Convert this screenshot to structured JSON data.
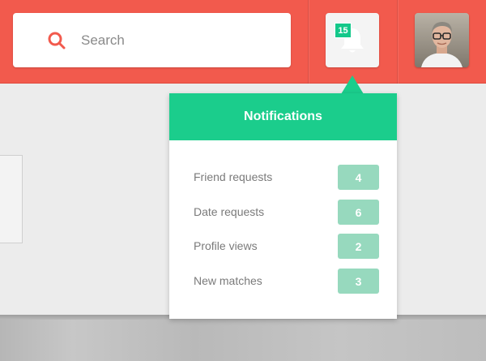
{
  "search": {
    "placeholder": "Search"
  },
  "notifications_button": {
    "badge": "15"
  },
  "dropdown": {
    "title": "Notifications",
    "items": [
      {
        "label": "Friend requests",
        "count": "4"
      },
      {
        "label": "Date requests",
        "count": "6"
      },
      {
        "label": "Profile views",
        "count": "2"
      },
      {
        "label": "New matches",
        "count": "3"
      }
    ]
  },
  "colors": {
    "topbar": "#f25a4d",
    "accent_green": "#1bcd8c",
    "count_badge": "#97d9be",
    "background": "#ececec"
  },
  "icons": {
    "search": "search-icon",
    "bell": "bell-icon",
    "avatar": "user-avatar"
  }
}
